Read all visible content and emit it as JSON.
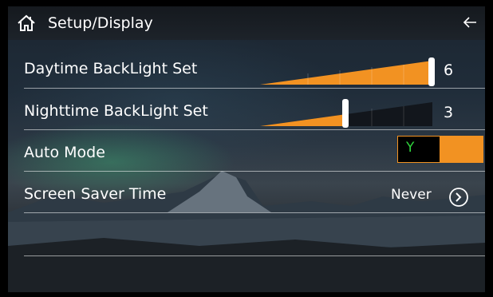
{
  "header": {
    "title": "Setup/Display",
    "home_icon": "home-icon",
    "back_icon": "back-arrow-icon"
  },
  "settings": {
    "daytime_backlight": {
      "label": "Daytime BackLight Set",
      "value": "6",
      "level": 1.0
    },
    "nighttime_backlight": {
      "label": "Nighttime BackLight Set",
      "value": "3",
      "level": 0.5
    },
    "auto_mode": {
      "label": "Auto Mode",
      "state": "Y"
    },
    "screen_saver": {
      "label": "Screen Saver Time",
      "value": "Never"
    }
  },
  "colors": {
    "accent": "#f29222",
    "toggle_text": "#2fd43c",
    "text": "#ffffff"
  }
}
